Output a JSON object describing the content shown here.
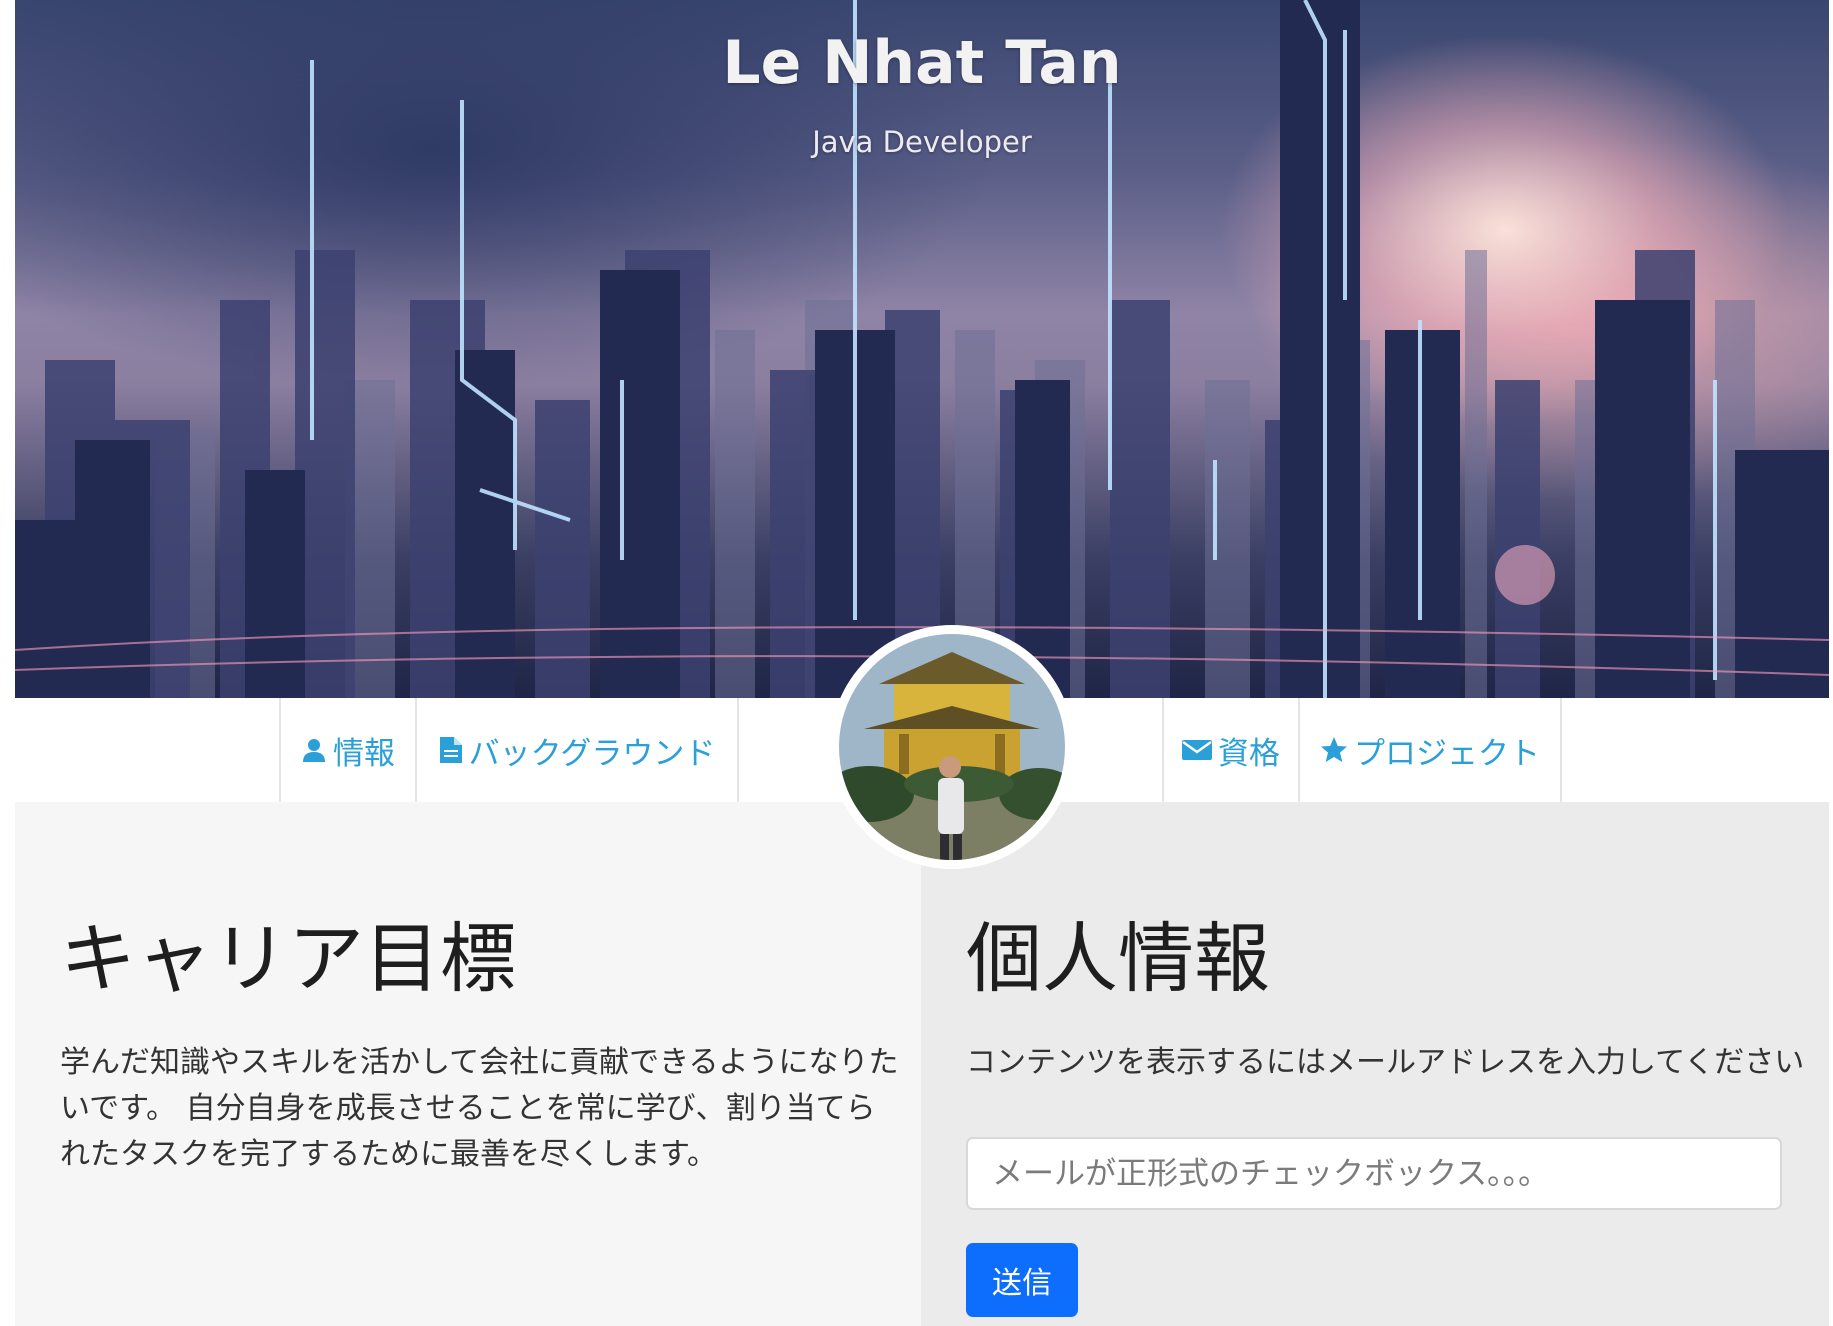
{
  "hero": {
    "name": "Le Nhat Tan",
    "subtitle": "Java Developer"
  },
  "nav": {
    "items": [
      {
        "label": "情報",
        "icon": "user-icon"
      },
      {
        "label": "バックグラウンド",
        "icon": "file-icon"
      },
      {
        "label": "資格",
        "icon": "envelope-icon"
      },
      {
        "label": "プロジェクト",
        "icon": "star-icon"
      }
    ],
    "color": "#2a9fd8"
  },
  "career": {
    "heading": "キャリア目標",
    "text": "学んだ知識やスキルを活かして会社に貢献できるようになりたいです。 自分自身を成長させることを常に学び、割り当てられたタスクを完了するために最善を尽くします。"
  },
  "personal": {
    "heading": "個人情報",
    "prompt": "コンテンツを表示するにはメールアドレスを入力してください",
    "email_placeholder": "メールが正形式のチェックボックス。。。",
    "email_value": "",
    "submit_label": "送信",
    "submit_color": "#0d6efd"
  }
}
